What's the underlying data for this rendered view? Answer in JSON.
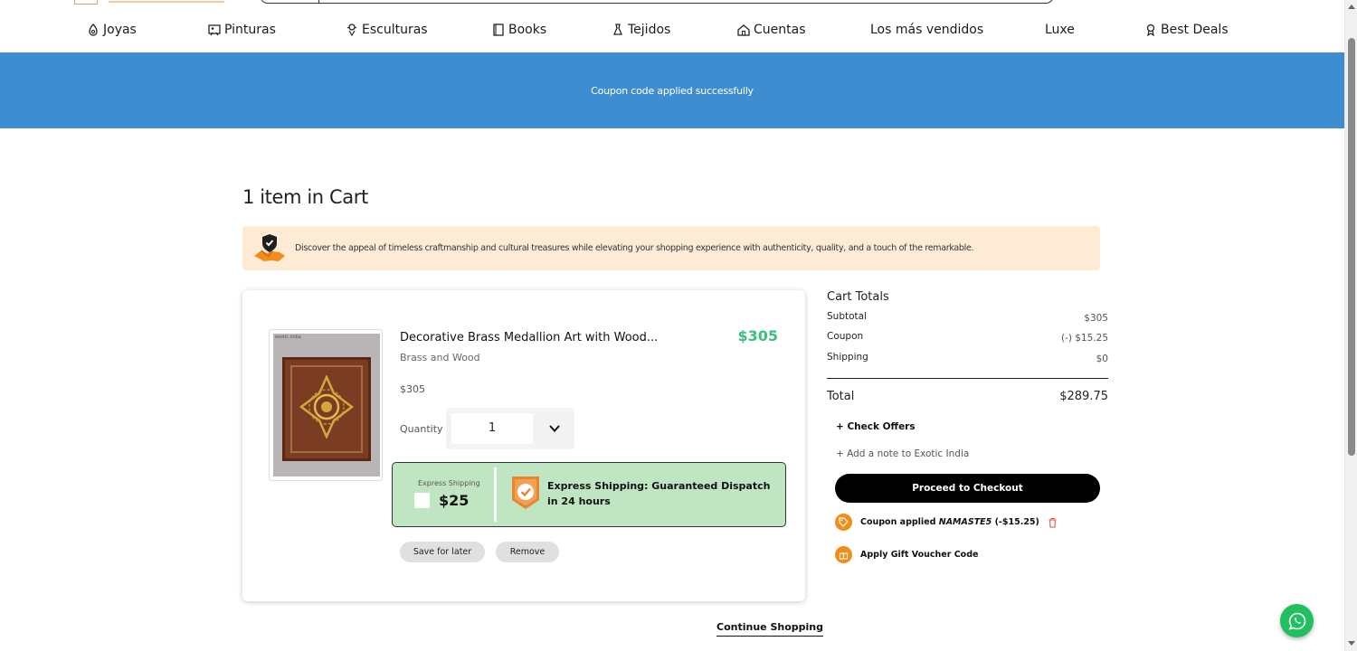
{
  "nav": {
    "items": [
      {
        "label": "Joyas",
        "icon": "gem-icon"
      },
      {
        "label": "Pinturas",
        "icon": "painting-icon"
      },
      {
        "label": "Esculturas",
        "icon": "sculpture-icon"
      },
      {
        "label": "Books",
        "icon": "book-icon"
      },
      {
        "label": "Tejidos",
        "icon": "textile-icon"
      },
      {
        "label": "Cuentas",
        "icon": "beads-icon"
      },
      {
        "label": "Los más vendidos",
        "icon": ""
      },
      {
        "label": "Luxe",
        "icon": ""
      },
      {
        "label": "Best Deals",
        "icon": "ribbon-icon"
      }
    ]
  },
  "banner": {
    "message": "Coupon code applied successfully",
    "color": "#3f8dd1"
  },
  "cart": {
    "title": "1 item in Cart",
    "trust_message": "Discover the appeal of timeless craftmanship and cultural treasures while elevating your shopping experience with authenticity, quality, and a touch of the remarkable.",
    "item": {
      "thumb_brand": "exotic india",
      "name": "Decorative Brass Medallion Art with Wood...",
      "material": "Brass and Wood",
      "price_highlight": "$305",
      "price": "$305",
      "quantity_label": "Quantity",
      "quantity": "1",
      "express": {
        "label": "Express Shipping",
        "price": "$25",
        "checked": false,
        "description": "Express Shipping: Guaranteed Dispatch in 24 hours"
      },
      "save_label": "Save for later",
      "remove_label": "Remove"
    },
    "continue_label": "Continue Shopping"
  },
  "totals": {
    "title": "Cart Totals",
    "subtotal_label": "Subtotal",
    "subtotal": "$305",
    "coupon_label": "Coupon",
    "coupon": "(-) $15.25",
    "shipping_label": "Shipping",
    "shipping": "$0",
    "total_label": "Total",
    "total": "$289.75",
    "check_offers": "Check Offers",
    "add_note": "Add a note to Exotic India",
    "checkout_label": "Proceed to Checkout",
    "coupon_applied_prefix": "Coupon applied",
    "coupon_code": "NAMASTE5",
    "coupon_amount": "(-$15.25)",
    "gift_label": "Apply Gift Voucher Code"
  },
  "colors": {
    "accent_green": "#3bbf7f",
    "express_bg": "#bfe5c3",
    "orange": "#f28c1b",
    "whatsapp": "#20c060"
  }
}
